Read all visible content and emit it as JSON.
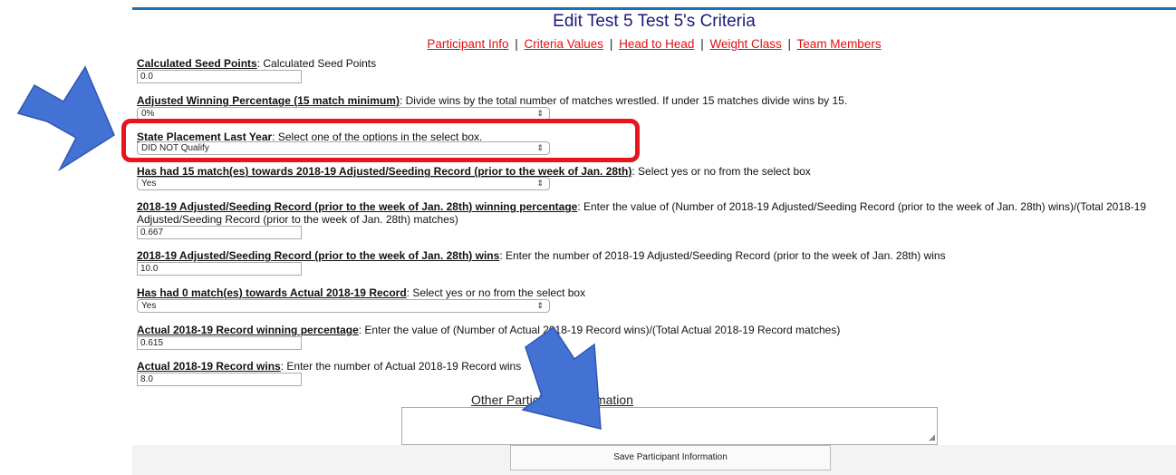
{
  "page": {
    "title": "Edit Test 5 Test 5's Criteria",
    "tabs": [
      "Participant Info",
      "Criteria Values",
      "Head to Head",
      "Weight Class",
      "Team Members"
    ],
    "separator": "|"
  },
  "fields": [
    {
      "label": "Calculated Seed Points",
      "desc": ": Calculated Seed Points",
      "type": "text",
      "value": "0.0"
    },
    {
      "label": "Adjusted Winning Percentage (15 match minimum)",
      "desc": ": Divide wins by the total number of matches wrestled. If under 15 matches divide wins by 15.",
      "type": "select",
      "value": "0%"
    },
    {
      "label": "State Placement Last Year",
      "desc": ": Select one of the options in the select box.",
      "type": "select",
      "value": "DID NOT Qualify"
    },
    {
      "label": "Has had 15 match(es) towards 2018-19 Adjusted/Seeding Record (prior to the week of Jan. 28th)",
      "desc": ": Select yes or no from the select box",
      "type": "select",
      "value": "Yes"
    },
    {
      "label": "2018-19 Adjusted/Seeding Record (prior to the week of Jan. 28th) winning percentage",
      "desc": ": Enter the value of (Number of 2018-19 Adjusted/Seeding Record (prior to the week of Jan. 28th) wins)/(Total 2018-19 Adjusted/Seeding Record (prior to the week of Jan. 28th) matches)",
      "type": "text",
      "value": "0.667"
    },
    {
      "label": "2018-19 Adjusted/Seeding Record (prior to the week of Jan. 28th) wins",
      "desc": ": Enter the number of 2018-19 Adjusted/Seeding Record (prior to the week of Jan. 28th) wins",
      "type": "text",
      "value": "10.0"
    },
    {
      "label": "Has had 0 match(es) towards Actual 2018-19 Record",
      "desc": ": Select yes or no from the select box",
      "type": "select",
      "value": "Yes"
    },
    {
      "label": "Actual 2018-19 Record winning percentage",
      "desc": ": Enter the value of (Number of Actual 2018-19 Record wins)/(Total Actual 2018-19 Record matches)",
      "type": "text",
      "value": "0.615"
    },
    {
      "label": "Actual 2018-19 Record wins",
      "desc": ": Enter the number of Actual 2018-19 Record wins",
      "type": "text",
      "value": "8.0"
    }
  ],
  "other": {
    "label": "Other Participant Information",
    "textarea_value": ""
  },
  "save_label": "Save Participant Information",
  "colors": {
    "link": "#e01010",
    "title": "#1a1a7a",
    "highlight": "#e8141c",
    "arrow": "#3b6fd0"
  }
}
